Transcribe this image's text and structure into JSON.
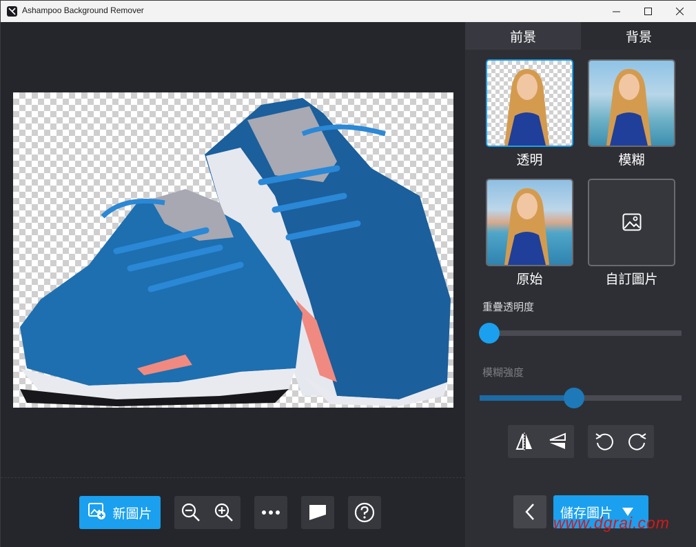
{
  "window": {
    "title": "Ashampoo Background Remover"
  },
  "tabs": [
    {
      "label": "前景",
      "active": true
    },
    {
      "label": "背景",
      "active": false
    }
  ],
  "backgrounds": [
    {
      "label": "透明",
      "selected": true,
      "kind": "transparent"
    },
    {
      "label": "模糊",
      "selected": false,
      "kind": "blur"
    },
    {
      "label": "原始",
      "selected": false,
      "kind": "original"
    },
    {
      "label": "自訂圖片",
      "selected": false,
      "kind": "custom",
      "icon": "image-icon"
    }
  ],
  "sliders": {
    "opacity": {
      "label": "重疊透明度",
      "value": 0.0
    },
    "blur": {
      "label": "模糊強度",
      "value": 0.47,
      "disabled": true
    }
  },
  "toolbar": {
    "new_image_label": "新圖片",
    "icons": [
      "add-image-icon",
      "zoom-out-icon",
      "zoom-in-icon",
      "more-icon",
      "compare-icon",
      "help-icon"
    ]
  },
  "actions": {
    "save_label": "儲存圖片"
  },
  "watermark": "www.dgrai.com",
  "colors": {
    "accent": "#1aa0ef",
    "panel": "#2e2f34",
    "canvas": "#25262b"
  }
}
